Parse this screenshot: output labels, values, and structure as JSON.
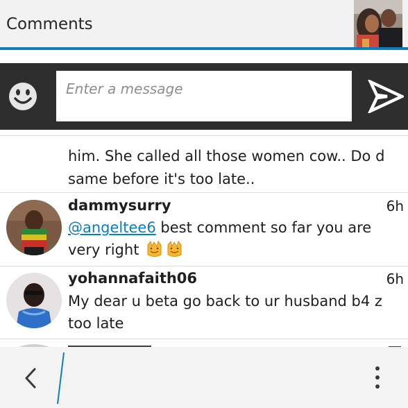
{
  "header": {
    "title": "Comments",
    "accent_color": "#0a7fc0"
  },
  "composer": {
    "emoji_icon": "smiley-icon",
    "placeholder": "Enter a message",
    "send_icon": "send-arrow-icon"
  },
  "comments": [
    {
      "text": "him. She called all those women cow.. Do d same before it's too late.."
    },
    {
      "username": "dammysurry",
      "time": "6h",
      "mention": "@angeltee6",
      "text": "best comment so far you are very right",
      "emojis": [
        "clapping-hands-emoji",
        "clapping-hands-emoji"
      ]
    },
    {
      "username": "yohannafaith06",
      "time": "6h",
      "text": "My dear u beta go back to ur husband b4 z too late"
    }
  ],
  "bottom_bar": {
    "back_icon": "chevron-left-icon",
    "more_icon": "more-vertical-icon"
  }
}
